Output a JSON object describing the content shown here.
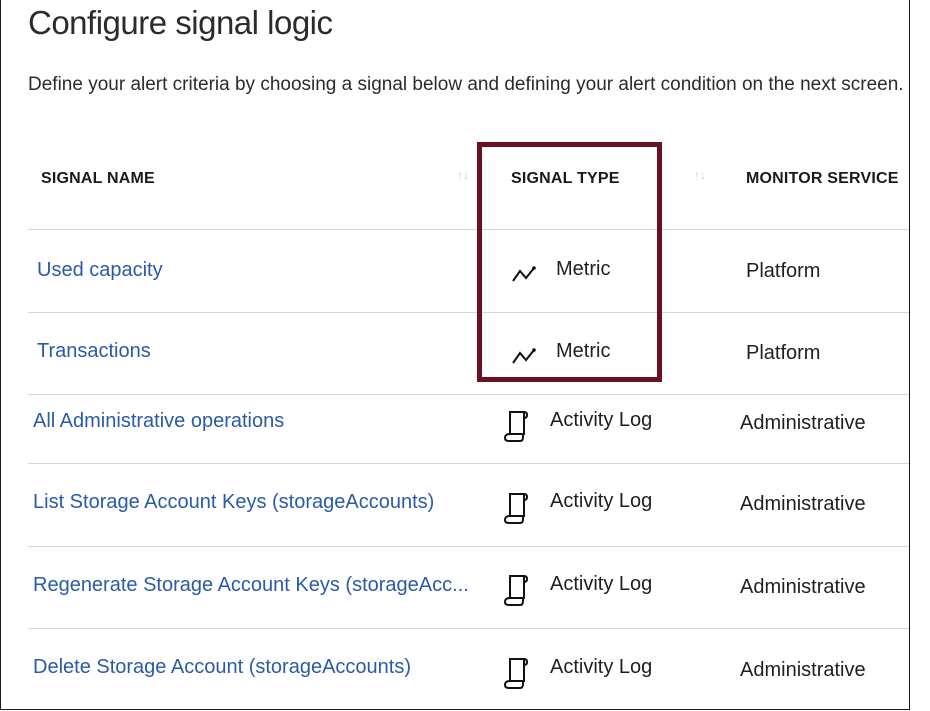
{
  "header": {
    "title": "Configure signal logic",
    "description": "Define your alert criteria by choosing a signal below and defining your alert condition on the next screen."
  },
  "columns": {
    "signal_name": "SIGNAL NAME",
    "signal_type": "SIGNAL TYPE",
    "monitor_service": "MONITOR SERVICE",
    "sort_glyph": "↑↓"
  },
  "rows": [
    {
      "name": "Used capacity",
      "type_icon": "metric-icon",
      "type": "Metric",
      "service": "Platform"
    },
    {
      "name": "Transactions",
      "type_icon": "metric-icon",
      "type": "Metric",
      "service": "Platform"
    },
    {
      "name": "All Administrative operations",
      "type_icon": "activity-log-icon",
      "type": "Activity Log",
      "service": "Administrative"
    },
    {
      "name": "List Storage Account Keys (storageAccounts)",
      "type_icon": "activity-log-icon",
      "type": "Activity Log",
      "service": "Administrative"
    },
    {
      "name": "Regenerate Storage Account Keys (storageAcc...",
      "type_icon": "activity-log-icon",
      "type": "Activity Log",
      "service": "Administrative"
    },
    {
      "name": "Delete Storage Account (storageAccounts)",
      "type_icon": "activity-log-icon",
      "type": "Activity Log",
      "service": "Administrative"
    }
  ],
  "colors": {
    "link": "#2a5aa8",
    "highlight_border": "#6b1020",
    "divider": "#d6d6d6"
  }
}
